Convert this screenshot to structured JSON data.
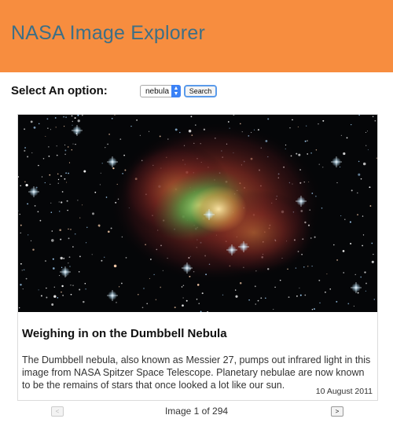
{
  "header": {
    "title": "NASA Image Explorer"
  },
  "controls": {
    "select_label": "Select An option:",
    "selected_option": "nebula",
    "search_label": "Search"
  },
  "card": {
    "image_icon": "nebula-photo",
    "title": "Weighing in on the Dumbbell Nebula",
    "description": "The Dumbbell nebula, also known as Messier 27, pumps out infrared light in this image from NASA Spitzer Space Telescope. Planetary nebulae are now known to be the remains of stars that once looked a lot like our sun.",
    "date": "10 August 2011"
  },
  "pager": {
    "prev_label": "<",
    "next_label": ">",
    "image_word": "Image",
    "current": "1",
    "of_word": "of",
    "total": "294"
  },
  "colors": {
    "header_bg": "#f78d3f",
    "title_color": "#3d6f86",
    "select_accent": "#3b82f6"
  }
}
